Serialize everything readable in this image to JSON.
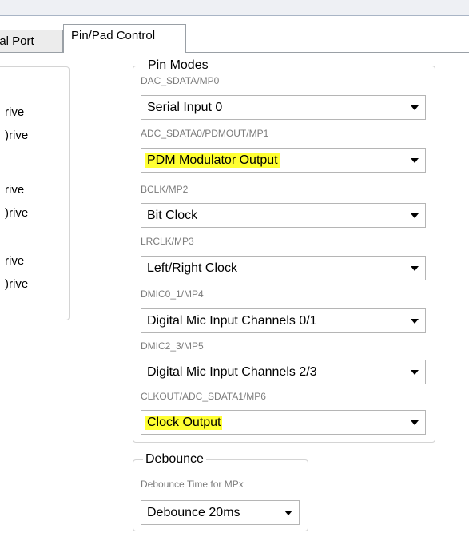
{
  "tabs": [
    {
      "label": "rial Port",
      "selected": false
    },
    {
      "label": "Pin/Pad Control",
      "selected": true
    }
  ],
  "left_panel": {
    "items": [
      "rive",
      ")rive",
      "rive",
      ")rive",
      "rive",
      ")rive"
    ]
  },
  "pin_modes": {
    "title": "Pin Modes",
    "fields": [
      {
        "label": "DAC_SDATA/MP0",
        "value": "Serial Input 0",
        "highlighted": false
      },
      {
        "label": "ADC_SDATA0/PDMOUT/MP1",
        "value": "PDM Modulator Output",
        "highlighted": true
      },
      {
        "label": "BCLK/MP2",
        "value": "Bit Clock",
        "highlighted": false
      },
      {
        "label": "LRCLK/MP3",
        "value": "Left/Right Clock",
        "highlighted": false
      },
      {
        "label": "DMIC0_1/MP4",
        "value": "Digital Mic Input Channels 0/1",
        "highlighted": false
      },
      {
        "label": "DMIC2_3/MP5",
        "value": "Digital Mic Input Channels 2/3",
        "highlighted": false
      },
      {
        "label": "CLKOUT/ADC_SDATA1/MP6",
        "value": "Clock Output",
        "highlighted": true
      }
    ]
  },
  "debounce": {
    "title": "Debounce",
    "label": "Debounce Time for MPx",
    "value": "Debounce 20ms"
  },
  "colors": {
    "highlight": "#ffff33",
    "label_gray": "#7c7c7c",
    "border": "#b5b5b5"
  }
}
